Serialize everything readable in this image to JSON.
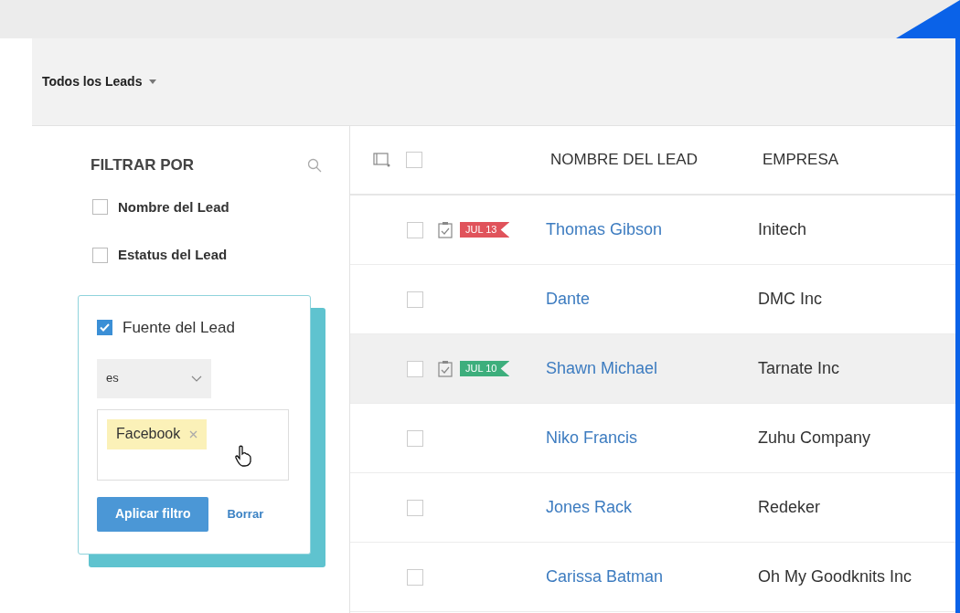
{
  "view_selector": {
    "label": "Todos los Leads"
  },
  "filter_panel": {
    "title": "FILTRAR POR",
    "fields": [
      {
        "label": "Nombre del Lead",
        "checked": false
      },
      {
        "label": "Estatus del Lead",
        "checked": false
      },
      {
        "label": "Fuente del Lead",
        "checked": true,
        "operator": "es",
        "values": [
          "Facebook"
        ],
        "apply_button": "Aplicar filtro",
        "clear_link": "Borrar"
      }
    ]
  },
  "table": {
    "select_all": {
      "checked": false
    },
    "columns": [
      "NOMBRE DEL LEAD",
      "EMPRESA"
    ],
    "rows": [
      {
        "name": "Thomas Gibson",
        "company": "Initech",
        "checked": false,
        "selected": false,
        "task": {
          "date": "JUL 13",
          "color": "#e0535b"
        }
      },
      {
        "name": "Dante",
        "company": "DMC Inc",
        "checked": false,
        "selected": false
      },
      {
        "name": "Shawn Michael",
        "company": "Tarnate Inc",
        "checked": false,
        "selected": true,
        "task": {
          "date": "JUL 10",
          "color": "#3dae7c"
        }
      },
      {
        "name": "Niko Francis",
        "company": "Zuhu Company",
        "checked": false,
        "selected": false
      },
      {
        "name": "Jones Rack",
        "company": "Redeker",
        "checked": false,
        "selected": false
      },
      {
        "name": "Carissa Batman",
        "company": "Oh My Goodknits Inc",
        "checked": false,
        "selected": false
      }
    ]
  }
}
